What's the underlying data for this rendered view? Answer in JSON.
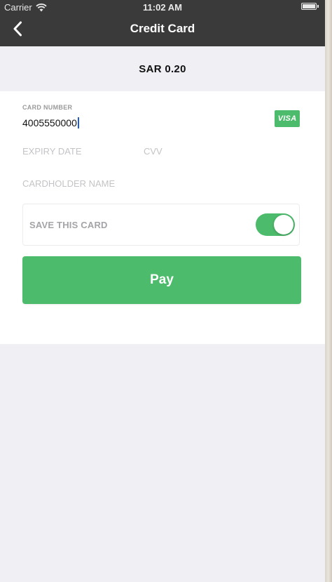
{
  "status_bar": {
    "carrier": "Carrier",
    "time": "11:02 AM"
  },
  "navbar": {
    "title": "Credit Card",
    "back_icon": "chevron-left-icon"
  },
  "payment": {
    "amount": "SAR 0.20"
  },
  "form": {
    "card_number_label": "CARD NUMBER",
    "card_number_value": "4005550000",
    "card_brand": "VISA",
    "expiry_placeholder": "EXPIRY DATE",
    "cvv_placeholder": "CVV",
    "cardholder_placeholder": "CARDHOLDER NAME",
    "save_card_label": "SAVE THIS CARD",
    "save_card_enabled": true,
    "pay_label": "Pay"
  },
  "colors": {
    "accent_green": "#4cbb6b",
    "navbar_bg": "#3a3a3a",
    "page_bg": "#efeff4"
  }
}
